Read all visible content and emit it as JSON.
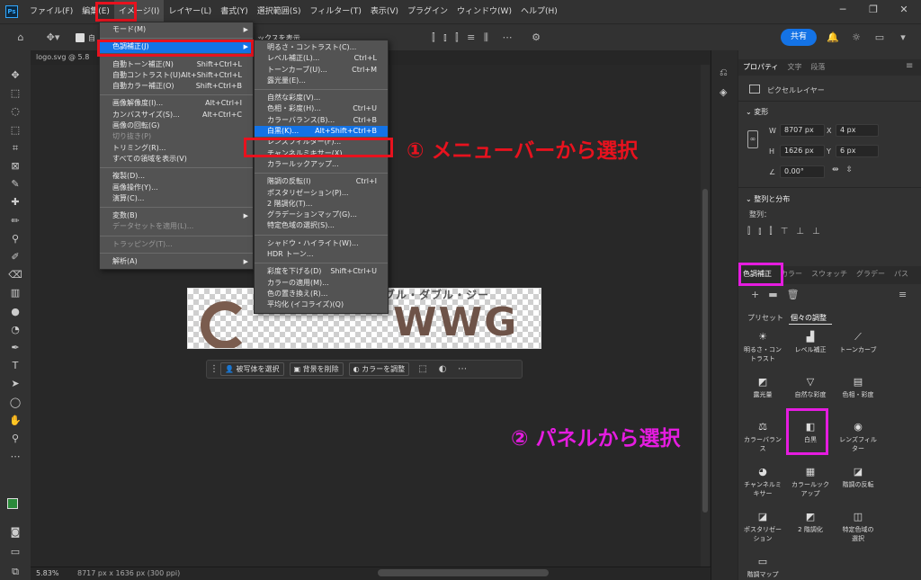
{
  "app": {
    "logo_text": "Ps"
  },
  "menubar": {
    "items": [
      "ファイル(F)",
      "編集(E)",
      "イメージ(I)",
      "レイヤー(L)",
      "書式(Y)",
      "選択範囲(S)",
      "フィルター(T)",
      "表示(V)",
      "プラグイン",
      "ウィンドウ(W)",
      "ヘルプ(H)"
    ],
    "active_index": 2
  },
  "window_controls": {
    "minimize": "─",
    "restore": "❐",
    "close": "✕"
  },
  "optionsbar": {
    "partial_label": "ックスを表示",
    "share_label": "共有",
    "partial_check_label": "自"
  },
  "document": {
    "tab_title": "logo.svg @ 5.8",
    "zoom": "5.83%",
    "dims": "8717 px x 1636 px (300 ppi)"
  },
  "artwork": {
    "kana": "ブル・ダブル・ジー",
    "letters": "WWG"
  },
  "context_bar": {
    "select_subject": "被写体を選択",
    "remove_bg": "背景を削除",
    "color_adjust": "カラーを調整"
  },
  "image_menu": {
    "rows": [
      {
        "label": "モード(M)",
        "shortcut": "",
        "submenu": true,
        "disabled": false
      },
      {
        "sep": true
      },
      {
        "label": "色調補正(J)",
        "shortcut": "",
        "submenu": true,
        "disabled": false,
        "highlight": true
      },
      {
        "sep": true
      },
      {
        "label": "自動トーン補正(N)",
        "shortcut": "Shift+Ctrl+L",
        "disabled": false
      },
      {
        "label": "自動コントラスト(U)",
        "shortcut": "Alt+Shift+Ctrl+L",
        "disabled": false
      },
      {
        "label": "自動カラー補正(O)",
        "shortcut": "Shift+Ctrl+B",
        "disabled": false
      },
      {
        "sep": true
      },
      {
        "label": "画像解像度(I)...",
        "shortcut": "Alt+Ctrl+I",
        "disabled": false
      },
      {
        "label": "カンバスサイズ(S)...",
        "shortcut": "Alt+Ctrl+C",
        "disabled": false
      },
      {
        "label": "画像の回転(G)",
        "shortcut": "",
        "disabled": false
      },
      {
        "label": "切り抜き(P)",
        "shortcut": "",
        "disabled": true
      },
      {
        "label": "トリミング(R)...",
        "shortcut": "",
        "disabled": false
      },
      {
        "label": "すべての領域を表示(V)",
        "shortcut": "",
        "disabled": false
      },
      {
        "sep": true
      },
      {
        "label": "複製(D)...",
        "shortcut": "",
        "disabled": false
      },
      {
        "label": "画像操作(Y)...",
        "shortcut": "",
        "disabled": false
      },
      {
        "label": "演算(C)...",
        "shortcut": "",
        "disabled": false
      },
      {
        "sep": true
      },
      {
        "label": "変数(B)",
        "shortcut": "",
        "submenu": true,
        "disabled": false
      },
      {
        "label": "データセットを適用(L)...",
        "shortcut": "",
        "disabled": true
      },
      {
        "sep": true
      },
      {
        "label": "トラッピング(T)...",
        "shortcut": "",
        "disabled": true
      },
      {
        "sep": true
      },
      {
        "label": "解析(A)",
        "shortcut": "",
        "submenu": true,
        "disabled": false
      }
    ]
  },
  "adjust_submenu": {
    "rows": [
      {
        "label": "明るさ・コントラスト(C)...",
        "shortcut": ""
      },
      {
        "label": "レベル補正(L)...",
        "shortcut": "Ctrl+L"
      },
      {
        "label": "トーンカーブ(U)...",
        "shortcut": "Ctrl+M"
      },
      {
        "label": "露光量(E)...",
        "shortcut": ""
      },
      {
        "sep": true
      },
      {
        "label": "自然な彩度(V)...",
        "shortcut": ""
      },
      {
        "label": "色相・彩度(H)...",
        "shortcut": "Ctrl+U"
      },
      {
        "label": "カラーバランス(B)...",
        "shortcut": "Ctrl+B"
      },
      {
        "label": "白黒(K)...",
        "shortcut": "Alt+Shift+Ctrl+B",
        "highlight": true
      },
      {
        "label": "レンズフィルター(F)...",
        "shortcut": ""
      },
      {
        "label": "チャンネルミキサー(X)...",
        "shortcut": ""
      },
      {
        "label": "カラールックアップ...",
        "shortcut": ""
      },
      {
        "sep": true
      },
      {
        "label": "階調の反転(I)",
        "shortcut": "Ctrl+I"
      },
      {
        "label": "ポスタリゼーション(P)...",
        "shortcut": ""
      },
      {
        "label": "2 階調化(T)...",
        "shortcut": ""
      },
      {
        "label": "グラデーションマップ(G)...",
        "shortcut": ""
      },
      {
        "label": "特定色域の選択(S)...",
        "shortcut": ""
      },
      {
        "sep": true
      },
      {
        "label": "シャドウ・ハイライト(W)...",
        "shortcut": ""
      },
      {
        "label": "HDR トーン...",
        "shortcut": ""
      },
      {
        "sep": true
      },
      {
        "label": "彩度を下げる(D)",
        "shortcut": "Shift+Ctrl+U"
      },
      {
        "label": "カラーの適用(M)...",
        "shortcut": ""
      },
      {
        "label": "色の置き換え(R)...",
        "shortcut": ""
      },
      {
        "label": "平均化 (イコライズ)(Q)",
        "shortcut": ""
      }
    ]
  },
  "annotations": {
    "menu_text": "① メニューバーから選択",
    "panel_text": "② パネルから選択",
    "red_color": "#e8121e",
    "magenta_color": "#e51ce0"
  },
  "properties_panel": {
    "tabs": [
      "プロパティ",
      "文字",
      "段落"
    ],
    "layer_type": "ピクセルレイヤー",
    "transform_header": "変形",
    "w": "8707 px",
    "h": "1626 px",
    "x": "4 px",
    "y": "6 px",
    "angle": "0.00°",
    "align_header": "整列と分布",
    "align_label": "整列："
  },
  "adjust_panel": {
    "tabs": [
      "色調補正",
      "カラー",
      "スウォッチ",
      "グラデー",
      "パス"
    ],
    "subtabs": [
      "プリセット",
      "個々の調整"
    ],
    "items": [
      {
        "icon": "brightness-icon",
        "glyph": "☀",
        "label": "明るさ・コン\nトラスト"
      },
      {
        "icon": "levels-icon",
        "glyph": "▟",
        "label": "レベル補正"
      },
      {
        "icon": "curves-icon",
        "glyph": "⟋",
        "label": "トーンカーブ"
      },
      {
        "icon": "exposure-icon",
        "glyph": "◩",
        "label": "露光量"
      },
      {
        "icon": "vibrance-icon",
        "glyph": "▽",
        "label": "自然な彩度"
      },
      {
        "icon": "hue-saturation-icon",
        "glyph": "▤",
        "label": "色相・彩度"
      },
      {
        "icon": "color-balance-icon",
        "glyph": "⚖",
        "label": "カラーバラン\nス"
      },
      {
        "icon": "black-white-icon",
        "glyph": "◧",
        "label": "白黒"
      },
      {
        "icon": "lens-filter-icon",
        "glyph": "◉",
        "label": "レンズフィル\nター"
      },
      {
        "icon": "channel-mixer-icon",
        "glyph": "◕",
        "label": "チャンネルミ\nキサー"
      },
      {
        "icon": "color-lookup-icon",
        "glyph": "▦",
        "label": "カラールック\nアップ"
      },
      {
        "icon": "invert-icon",
        "glyph": "◪",
        "label": "階調の反転"
      },
      {
        "icon": "posterize-icon",
        "glyph": "◪",
        "label": "ポスタリゼー\nション"
      },
      {
        "icon": "threshold-icon",
        "glyph": "◩",
        "label": "2 階調化"
      },
      {
        "icon": "selective-color-icon",
        "glyph": "◫",
        "label": "特定色域の\n選択"
      },
      {
        "icon": "gradient-map-icon",
        "glyph": "▭",
        "label": "階調マップ"
      }
    ]
  }
}
